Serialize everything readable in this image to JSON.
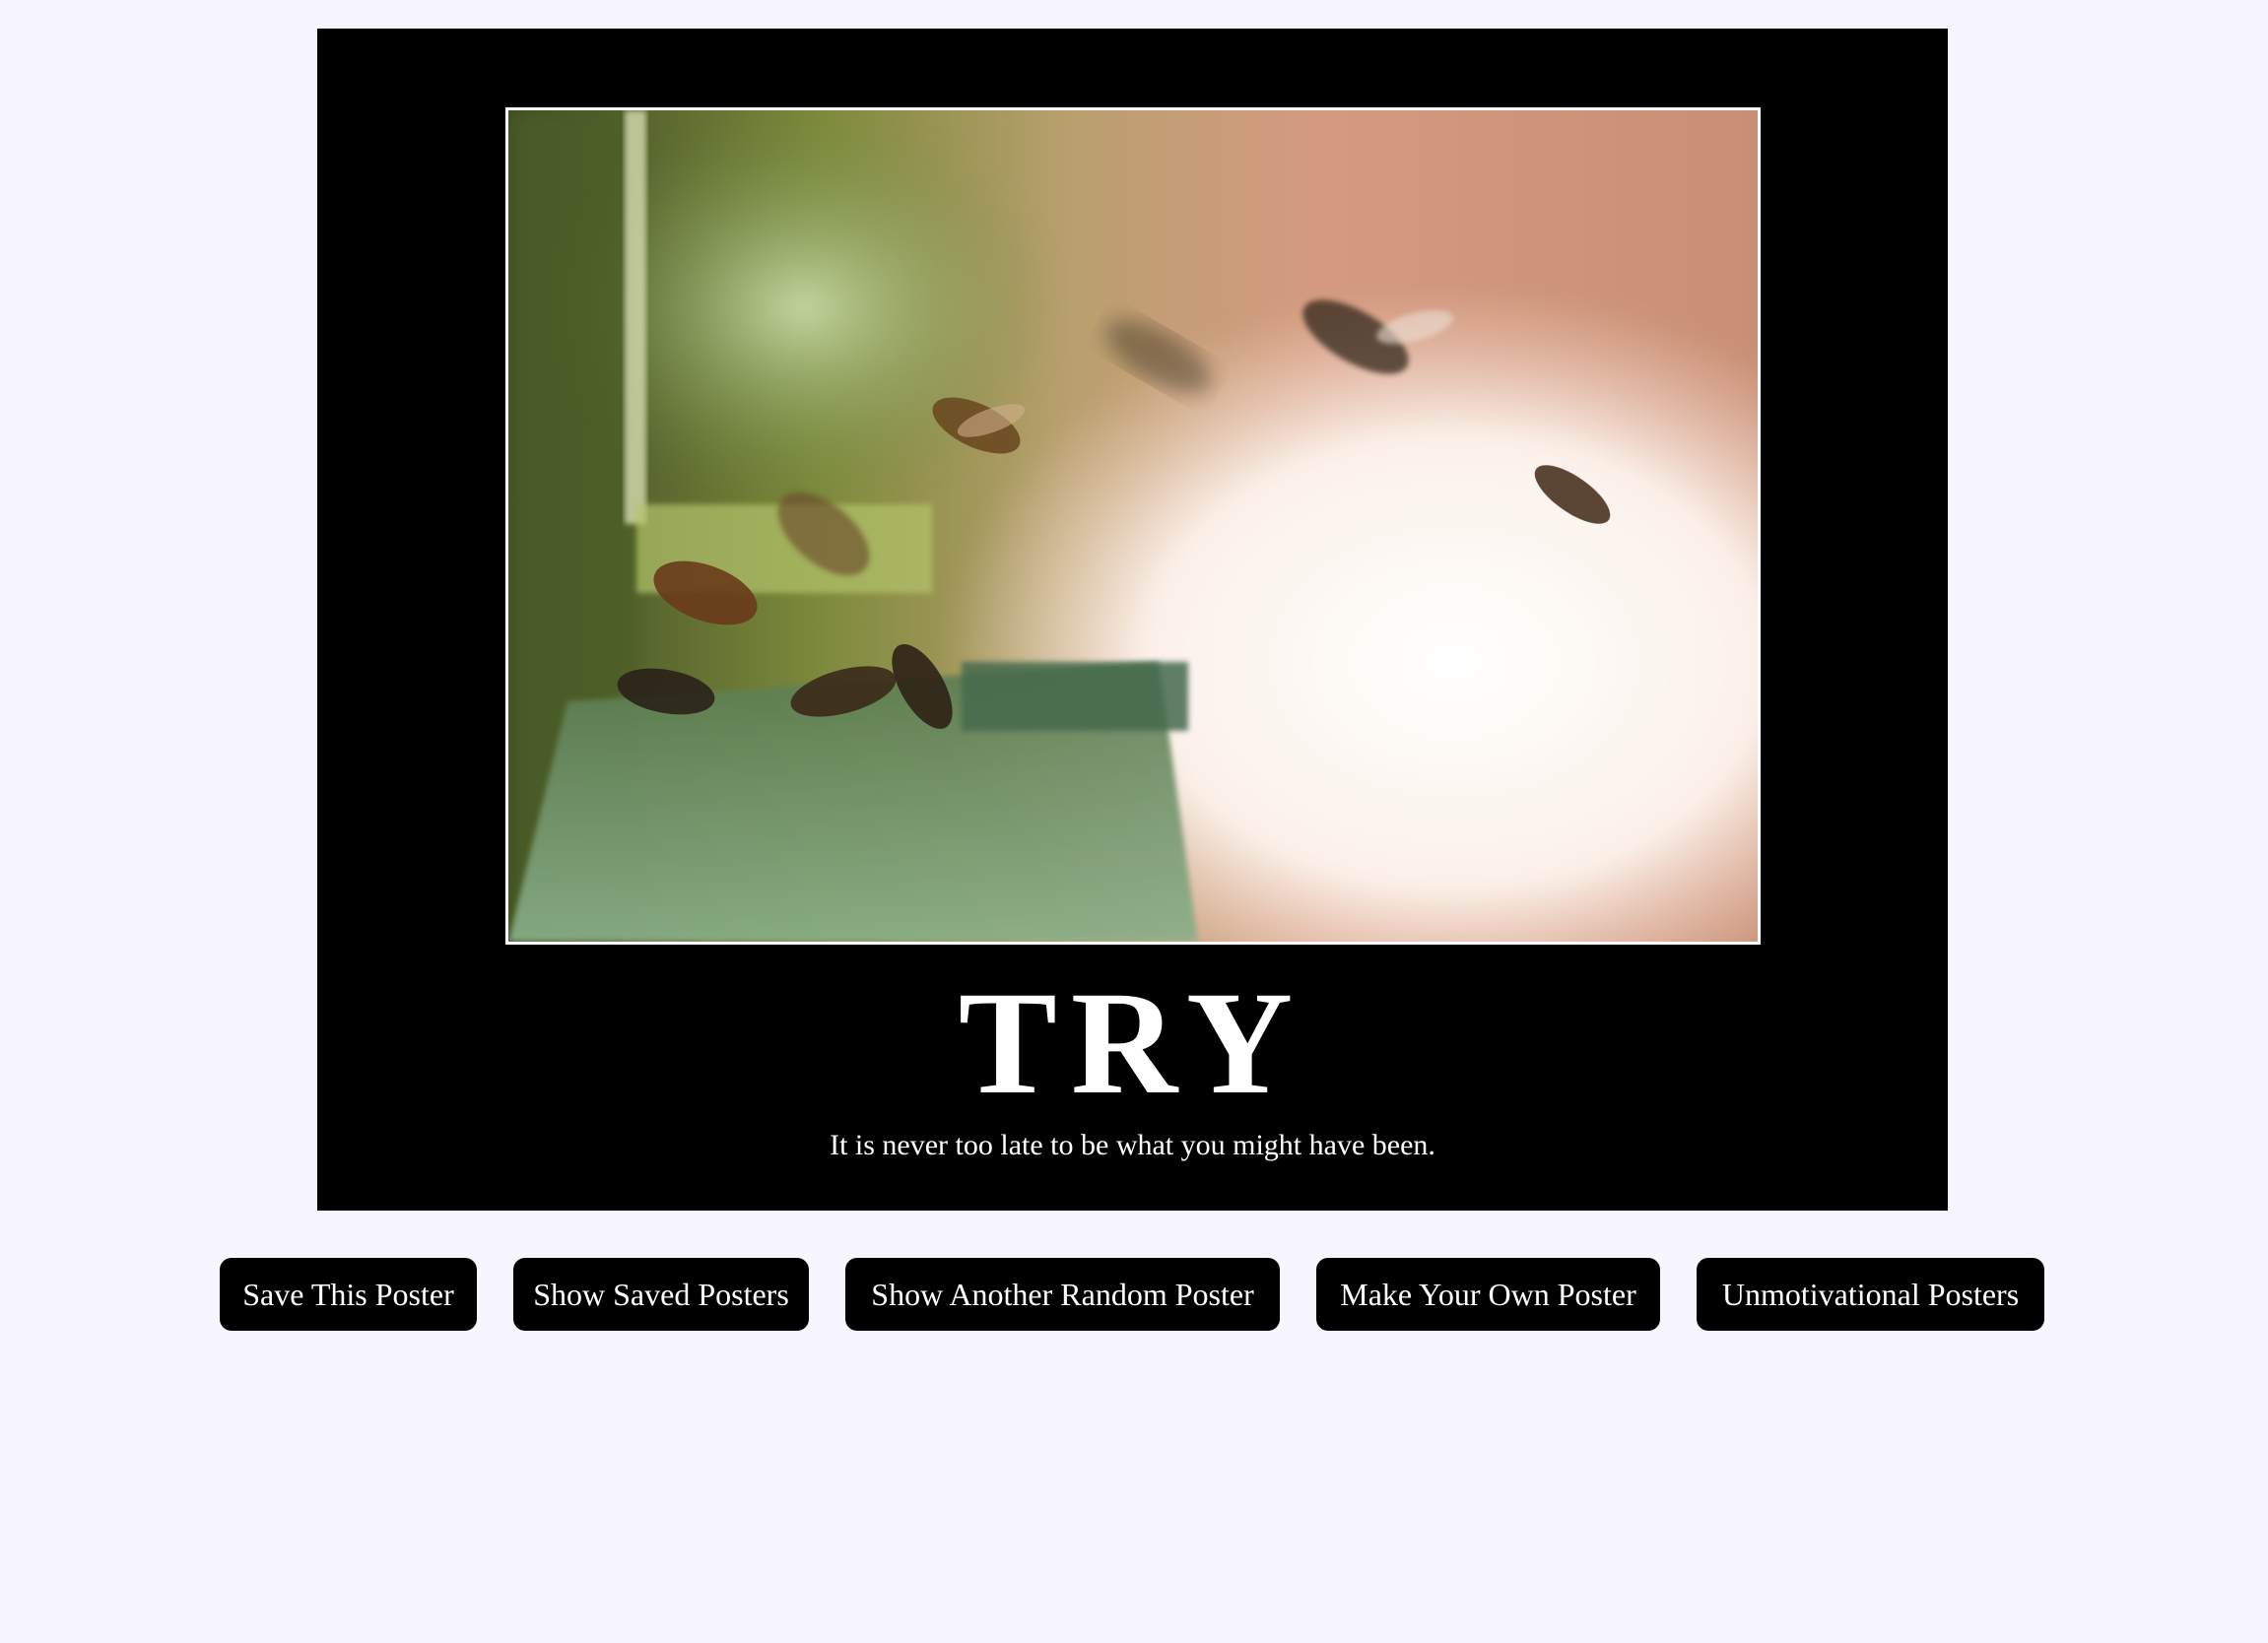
{
  "poster": {
    "title": "TRY",
    "quote": "It is never too late to be what you might have been.",
    "image_subject": "honeybees flying at hive entrance"
  },
  "buttons": {
    "save": "Save This Poster",
    "show_saved": "Show Saved Posters",
    "random": "Show Another Random Poster",
    "make_own": "Make Your Own Poster",
    "unmotivational": "Unmotivational Posters"
  },
  "colors": {
    "page_background": "#f7f6ff",
    "poster_background": "#000000",
    "button_background": "#000000",
    "text": "#ffffff"
  }
}
